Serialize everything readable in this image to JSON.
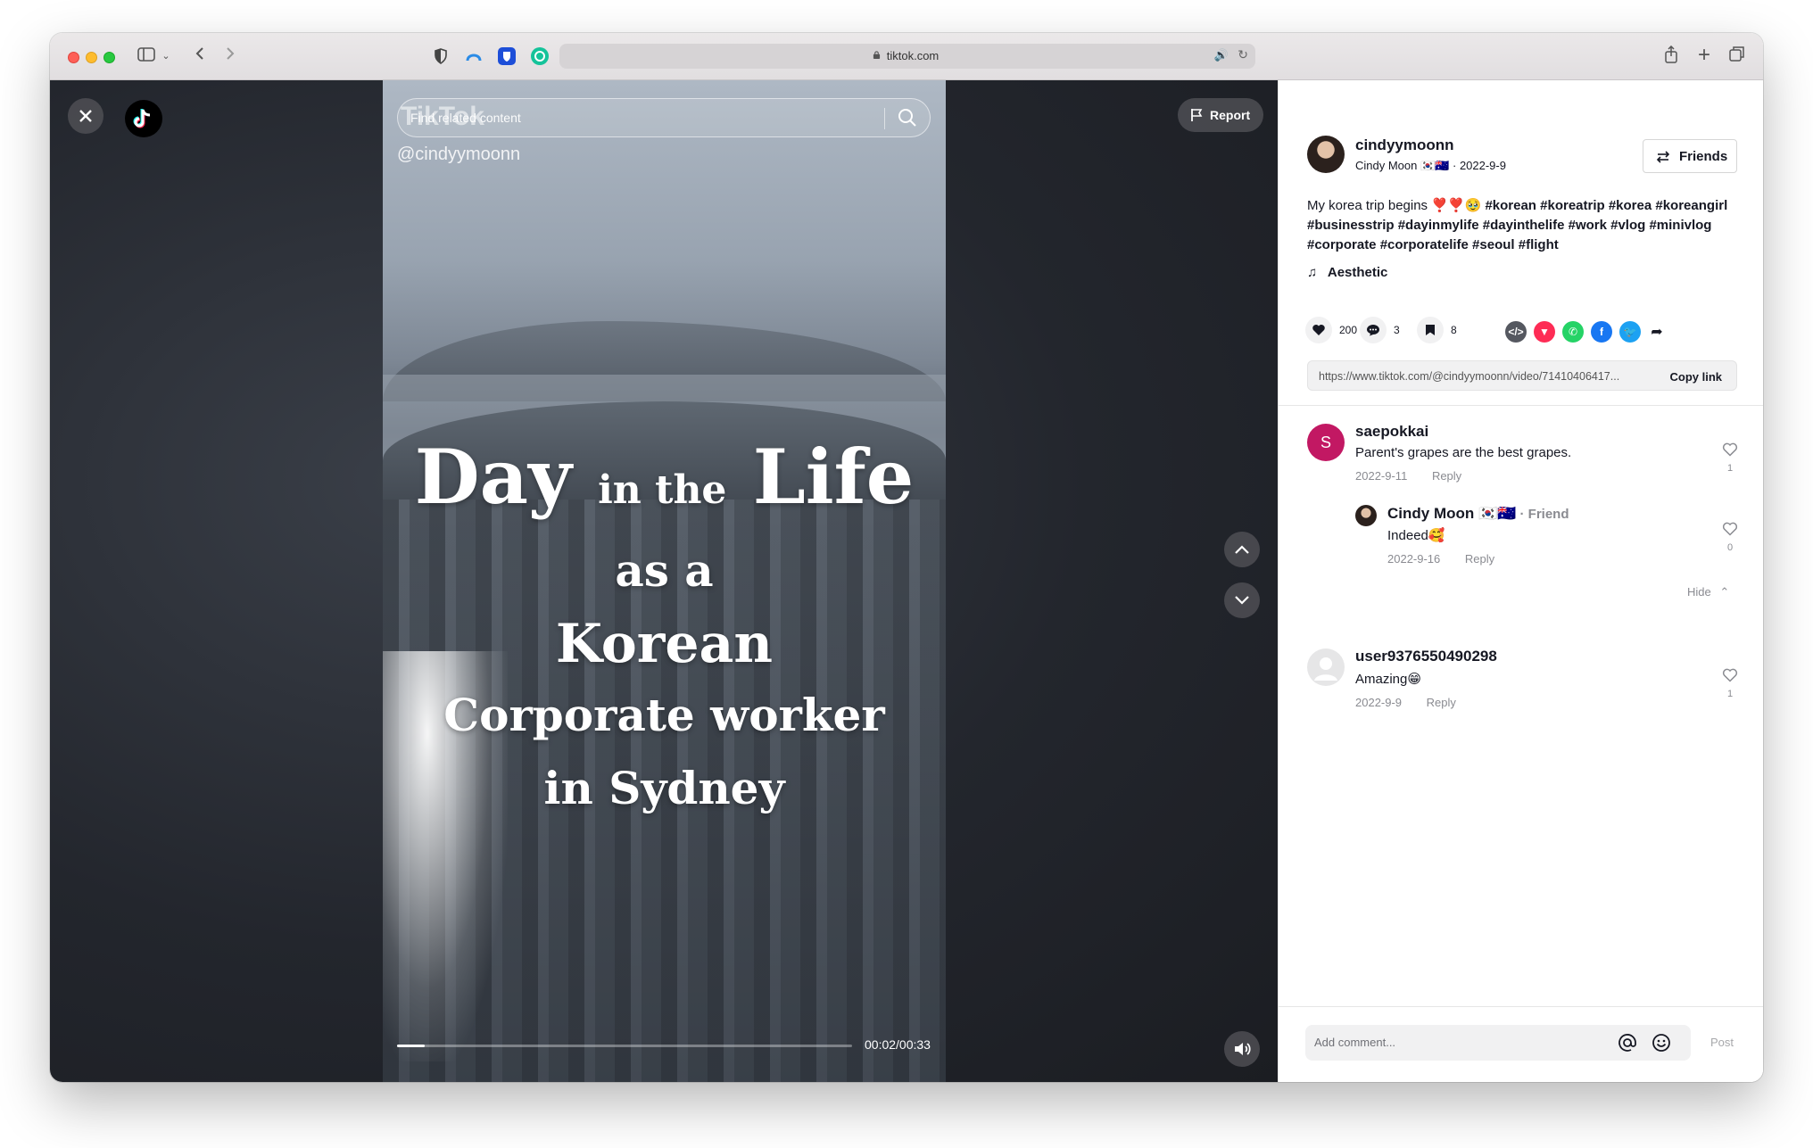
{
  "browser": {
    "url": "tiktok.com"
  },
  "video": {
    "search_placeholder": "Find related content",
    "watermark_logo": "TikTok",
    "watermark_user": "@cindyymoonn",
    "overlay": {
      "line1_a": "Day",
      "line1_b": "in the",
      "line1_c": "Life",
      "line2": "as a",
      "line3": "Korean",
      "line4": "Corporate worker",
      "line5": "in Sydney"
    },
    "time": "00:02/00:33",
    "progress": 0.06,
    "report_label": "Report"
  },
  "post": {
    "username": "cindyymoonn",
    "display_name": "Cindy Moon 🇰🇷🇦🇺",
    "date": "2022-9-9",
    "friends_label": "Friends",
    "description": "My korea trip begins ❣️❣️🥹",
    "hashtags": "#korean #koreatrip #korea #koreangirl #businesstrip #dayinmylife #dayinthelife #work #vlog #minivlog #corporate #corporatelife #seoul #flight",
    "music": "Aesthetic",
    "likes": "200",
    "comments": "3",
    "saves": "8",
    "link": "https://www.tiktok.com/@cindyymoonn/video/71410406417...",
    "copy_label": "Copy link"
  },
  "comments": [
    {
      "avatar_letter": "S",
      "name": "saepokkai",
      "text": "Parent's grapes are the best grapes.",
      "date": "2022-9-11",
      "reply_label": "Reply",
      "likes": "1"
    },
    {
      "name": "Cindy Moon 🇰🇷🇦🇺",
      "tag": " · Friend",
      "text": "Indeed🥰",
      "date": "2022-9-16",
      "reply_label": "Reply",
      "likes": "0"
    },
    {
      "name": "user9376550490298",
      "text": "Amazing😁",
      "date": "2022-9-9",
      "reply_label": "Reply",
      "likes": "1"
    }
  ],
  "hide_label": "Hide",
  "comment_input": {
    "placeholder": "Add comment...",
    "post_label": "Post"
  },
  "colors": {
    "accent": "#fe2c55",
    "text": "#161823",
    "muted": "#8a8b91"
  }
}
